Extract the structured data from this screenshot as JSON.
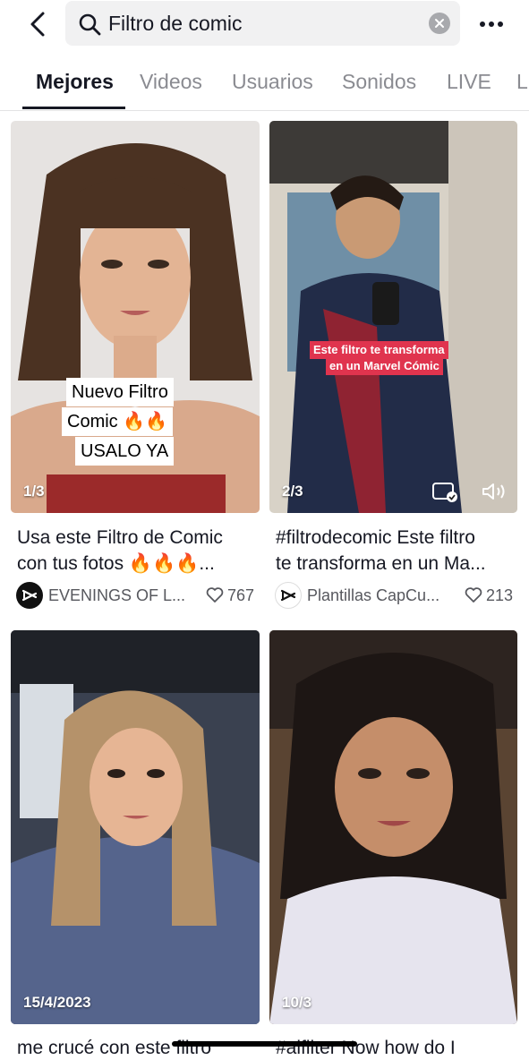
{
  "search": {
    "query": "Filtro de comic"
  },
  "tabs": [
    {
      "label": "Mejores",
      "active": true
    },
    {
      "label": "Videos",
      "active": false
    },
    {
      "label": "Usuarios",
      "active": false
    },
    {
      "label": "Sonidos",
      "active": false
    },
    {
      "label": "LIVE",
      "active": false
    },
    {
      "label": "Lu",
      "active": false
    }
  ],
  "results": [
    {
      "overlay_lines": [
        "Nuevo Filtro",
        "Comic 🔥🔥",
        "USALO YA"
      ],
      "counter": "1/3",
      "caption_line1": "Usa este Filtro de Comic",
      "caption_line2": "con tus fotos 🔥🔥🔥...",
      "author": "EVENINGS OF L...",
      "likes": "767"
    },
    {
      "overlay_lines": [
        "Este filtro te transforma",
        "en un Marvel Cómic"
      ],
      "counter": "2/3",
      "caption_line1": "#filtrodecomic Este filtro",
      "caption_line2": "te transforma en un Ma...",
      "author": "Plantillas CapCu...",
      "likes": "213"
    },
    {
      "counter": "15/4/2023",
      "caption_line1": "me crucé con este filtro"
    },
    {
      "counter": "10/3",
      "caption_line1": "#aifilter Now how do I"
    }
  ],
  "colors": {
    "accent": "#161823",
    "muted": "#8a8b91",
    "overlay_red": "#e0344e"
  }
}
